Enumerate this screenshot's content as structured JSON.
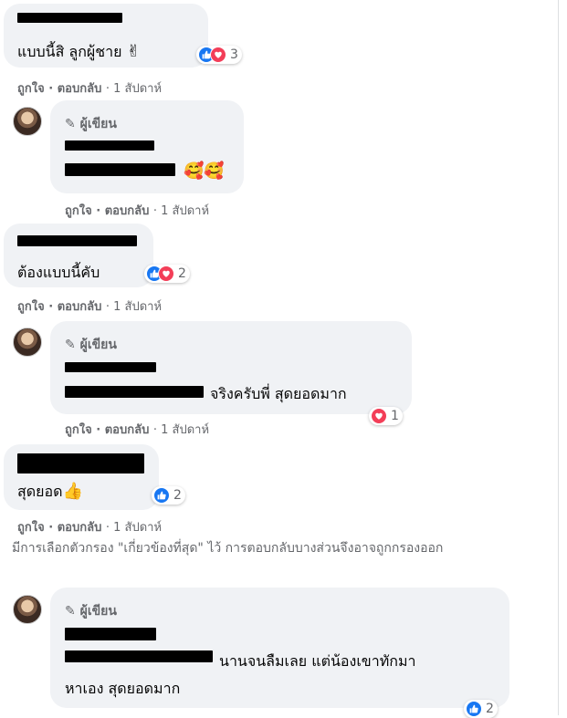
{
  "actions": {
    "like": "ถูกใจ",
    "reply": "ตอบกลับ",
    "sep": "·",
    "time": "1 สัปดาห์"
  },
  "author_badge": "ผู้เขียน",
  "comments": [
    {
      "text": "แบบนี้สิ ลูกผู้ชาย",
      "emoji": "✌",
      "reaction_count": "3"
    },
    {
      "emoji": "🥰🥰"
    },
    {
      "text": "ต้องแบบนี้คับ",
      "reaction_count": "2"
    },
    {
      "text": "จริงครับพี่ สุดยอดมาก",
      "reaction_count": "1"
    },
    {
      "text": "สุดยอด",
      "emoji": "👍",
      "reaction_count": "2"
    },
    {
      "text_line1": "นานจนลืมเลย แต่น้องเขาทักมา",
      "text_line2": "หาเอง สุดยอดมาก",
      "reaction_count": "2"
    }
  ],
  "filter_notice": "มีการเลือกตัวกรอง \"เกี่ยวข้องที่สุด\" ไว้ การตอบกลับบางส่วนจึงอาจถูกกรองออก",
  "colors": {
    "like": "#1877f2",
    "love": "#f33e58",
    "bubble": "#f0f2f5",
    "meta": "#65676b"
  }
}
